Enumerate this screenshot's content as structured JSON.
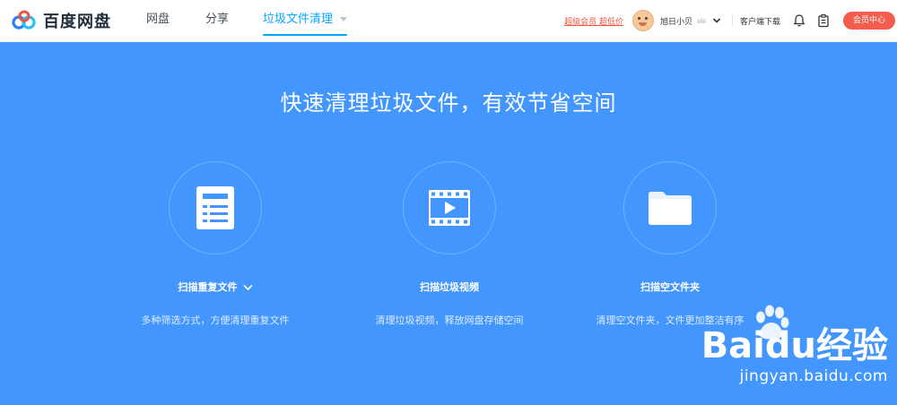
{
  "app": {
    "logo_text": "百度网盘"
  },
  "nav": {
    "items": [
      {
        "label": "网盘"
      },
      {
        "label": "分享"
      },
      {
        "label": "垃圾文件清理"
      }
    ]
  },
  "header_right": {
    "vip_link": "超级会员 超低价",
    "username": "旭日小贝",
    "client_download": "客户端下载",
    "member_center": "会员中心"
  },
  "main": {
    "headline": "快速清理垃圾文件，有效节省空间",
    "cards": [
      {
        "title": "扫描重复文件",
        "desc": "多种筛选方式，方便清理重复文件",
        "icon": "document-list-icon"
      },
      {
        "title": "扫描垃圾视频",
        "desc": "清理垃圾视频，释放网盘存储空间",
        "icon": "film-play-icon"
      },
      {
        "title": "扫描空文件夹",
        "desc": "清理空文件夹，文件更加整洁有序",
        "icon": "folder-icon"
      }
    ]
  },
  "watermark": {
    "brand": "Baidu经验",
    "url": "jingyan.baidu.com"
  },
  "colors": {
    "accent": "#06a7ff",
    "panel_bg": "#4296fd",
    "member_btn": "#f25d4e"
  }
}
